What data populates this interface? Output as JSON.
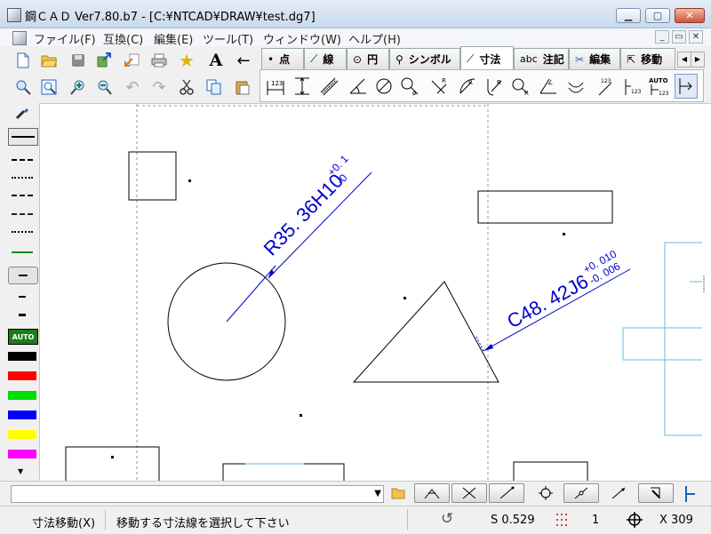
{
  "window": {
    "title": "鋼ＣＡＤ Ver7.80.b7 - [C:¥NTCAD¥DRAW¥test.dg7]",
    "controls": {
      "minimize": "▁",
      "maximize": "▢",
      "close": "✕"
    }
  },
  "menu": {
    "items": [
      "ファイル(F)",
      "互換(C)",
      "編集(E)",
      "ツール(T)",
      "ウィンドウ(W)",
      "ヘルプ(H)"
    ],
    "mdi": {
      "minimize": "_",
      "restore": "▭",
      "close": "✕"
    }
  },
  "tabs": [
    {
      "icon": "•",
      "label": "点"
    },
    {
      "icon": "⟋",
      "label": "線"
    },
    {
      "icon": "⊙",
      "label": "円"
    },
    {
      "icon": "⚲",
      "label": "シンボル"
    },
    {
      "icon": "⟋",
      "label": "寸法"
    },
    {
      "icon": "abc",
      "label": "注記"
    },
    {
      "icon": "✂",
      "label": "編集"
    },
    {
      "icon": "⇱",
      "label": "移動"
    }
  ],
  "tab_scroll": {
    "left": "◀",
    "right": "▶"
  },
  "dim_toolbar_labels": {
    "b1": "123",
    "b11": "AUTO"
  },
  "canvas": {
    "dim1": {
      "main": "R35. 36H10",
      "upper": "+0. 1",
      "lower": "-0"
    },
    "dim2": {
      "main": "C48. 42J6",
      "upper": "+0. 010",
      "lower": "-0. 006"
    }
  },
  "palette": {
    "auto_label": "AUTO"
  },
  "colors": {
    "accent": "#0000cc",
    "palette": [
      "#000000",
      "#ff0000",
      "#00dd00",
      "#0000ff",
      "#ffff00",
      "#ff00ff"
    ]
  },
  "status": {
    "command": "寸法移動(X)",
    "message": "移動する寸法線を選択して下さい",
    "scale": "S 0.529",
    "layer": "1",
    "xcoord": "X 309"
  }
}
